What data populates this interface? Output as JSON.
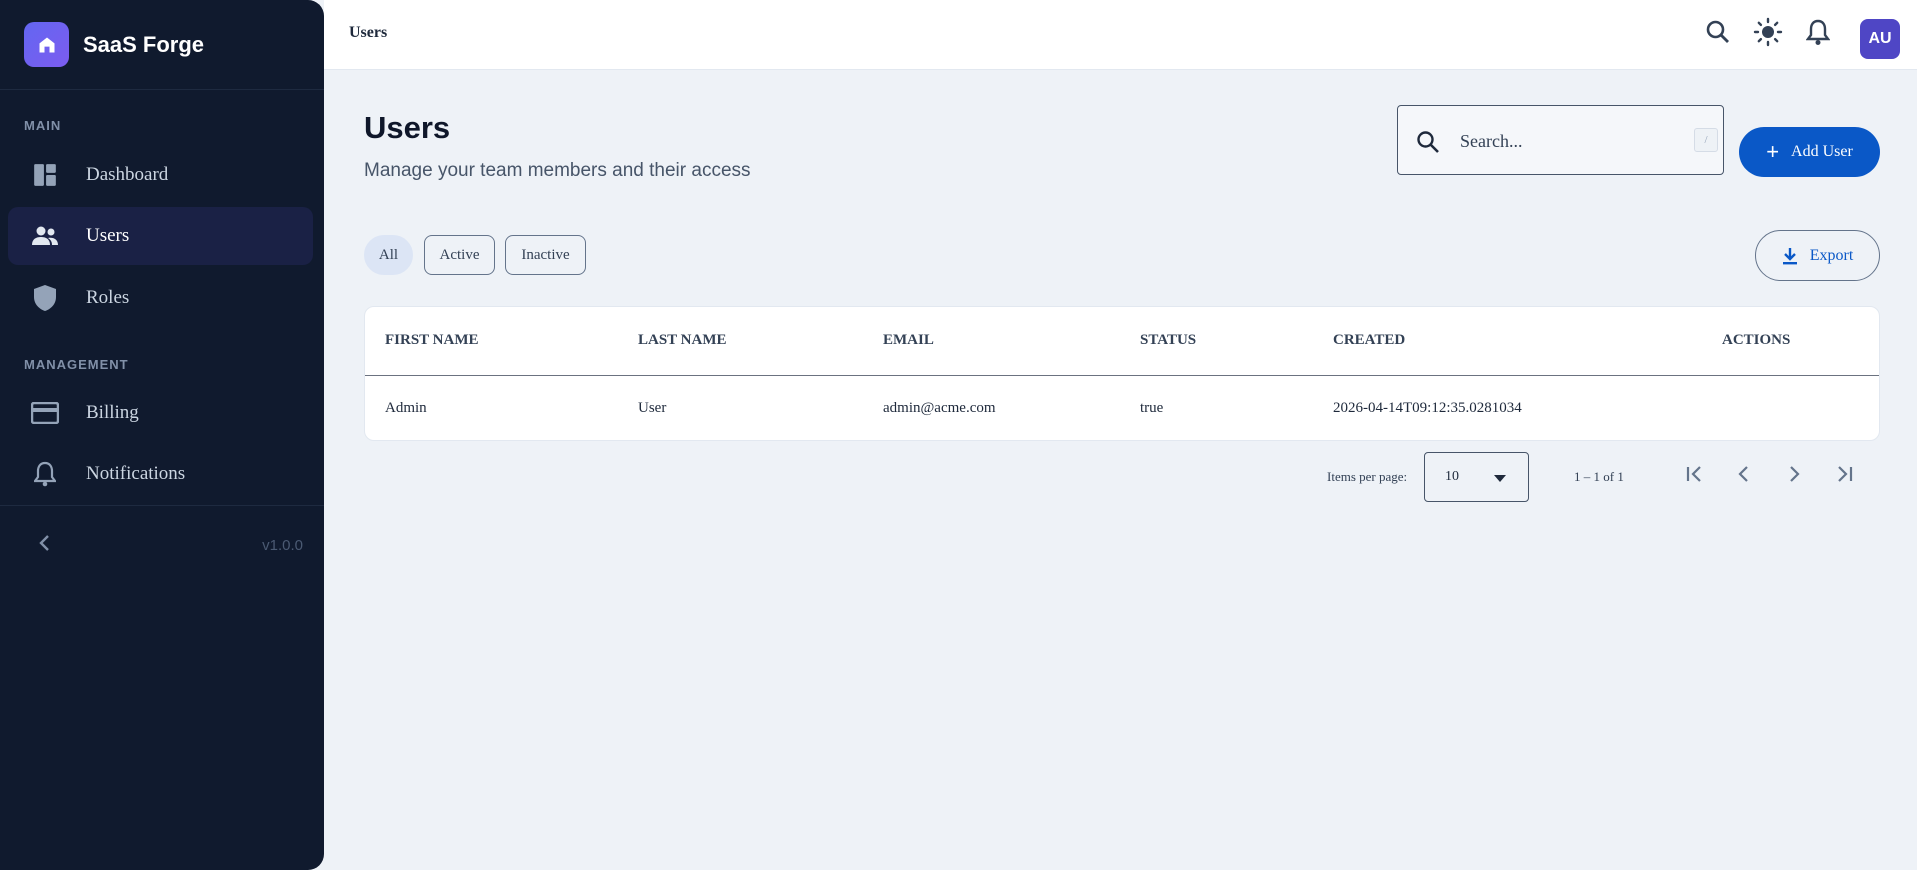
{
  "app": {
    "name": "SaaS Forge",
    "version": "v1.0.0"
  },
  "sidebar": {
    "sections": [
      {
        "label": "MAIN"
      },
      {
        "label": "MANAGEMENT"
      }
    ],
    "items": [
      {
        "label": "Dashboard",
        "icon": "dashboard-icon",
        "active": false
      },
      {
        "label": "Users",
        "icon": "users-icon",
        "active": true
      },
      {
        "label": "Roles",
        "icon": "shield-icon",
        "active": false
      },
      {
        "label": "Billing",
        "icon": "credit-card-icon",
        "active": false
      },
      {
        "label": "Notifications",
        "icon": "bell-icon",
        "active": false
      }
    ]
  },
  "topbar": {
    "breadcrumb": "Users",
    "icons": [
      "search-icon",
      "theme-sun-icon",
      "bell-icon"
    ],
    "avatar_initials": "AU"
  },
  "page": {
    "title": "Users",
    "subtitle": "Manage your team members and their access"
  },
  "search": {
    "placeholder": "Search...",
    "shortcut": "/"
  },
  "actions": {
    "add_user": "Add User",
    "export": "Export"
  },
  "filters": [
    {
      "label": "All",
      "selected": true
    },
    {
      "label": "Active",
      "selected": false
    },
    {
      "label": "Inactive",
      "selected": false
    }
  ],
  "table": {
    "columns": [
      "FIRST NAME",
      "LAST NAME",
      "EMAIL",
      "STATUS",
      "CREATED",
      "ACTIONS"
    ],
    "rows": [
      [
        "Admin",
        "User",
        "admin@acme.com",
        "true",
        "2026-04-14T09:12:35.0281034",
        ""
      ]
    ]
  },
  "pagination": {
    "items_per_page_label": "Items per page:",
    "items_per_page": "10",
    "range": "1 – 1 of 1"
  },
  "colors": {
    "sidebar_bg": "#101a2e",
    "accent": "#0a58c7",
    "brand": "#6366f1",
    "page_bg": "#eef2f7"
  }
}
